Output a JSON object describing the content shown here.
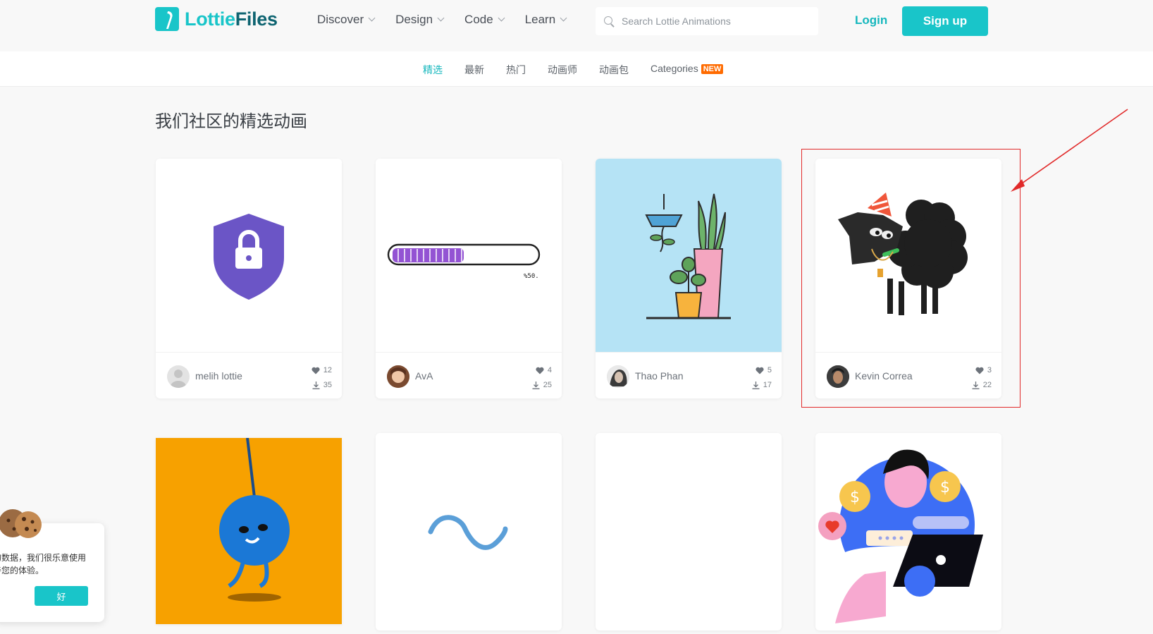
{
  "header": {
    "logo_part1": "Lottie",
    "logo_part2": "Files",
    "nav": [
      "Discover",
      "Design",
      "Code",
      "Learn"
    ],
    "search_placeholder": "Search Lottie Animations",
    "login_label": "Login",
    "signup_label": "Sign up"
  },
  "subnav": {
    "items": [
      "精选",
      "最新",
      "热门",
      "动画师",
      "动画包",
      "Categories"
    ],
    "new_badge": "NEW"
  },
  "section_title": "我们社区的精选动画",
  "cards": [
    {
      "author": "melih lottie",
      "likes": "12",
      "downloads": "35"
    },
    {
      "author": "AvA",
      "likes": "4",
      "downloads": "25"
    },
    {
      "author": "Thao Phan",
      "likes": "5",
      "downloads": "17"
    },
    {
      "author": "Kevin Correa",
      "likes": "3",
      "downloads": "22"
    }
  ],
  "progress_label": "%50.",
  "progress_fraction": 0.5,
  "cookie": {
    "line1": "的数据，我们很乐意使用",
    "line2": "善您的体验。",
    "button": "好"
  },
  "colors": {
    "brand": "#19c5c9",
    "brand_dark": "#0e6471",
    "new_badge": "#ff6b00",
    "annotation": "#e12a2a"
  }
}
